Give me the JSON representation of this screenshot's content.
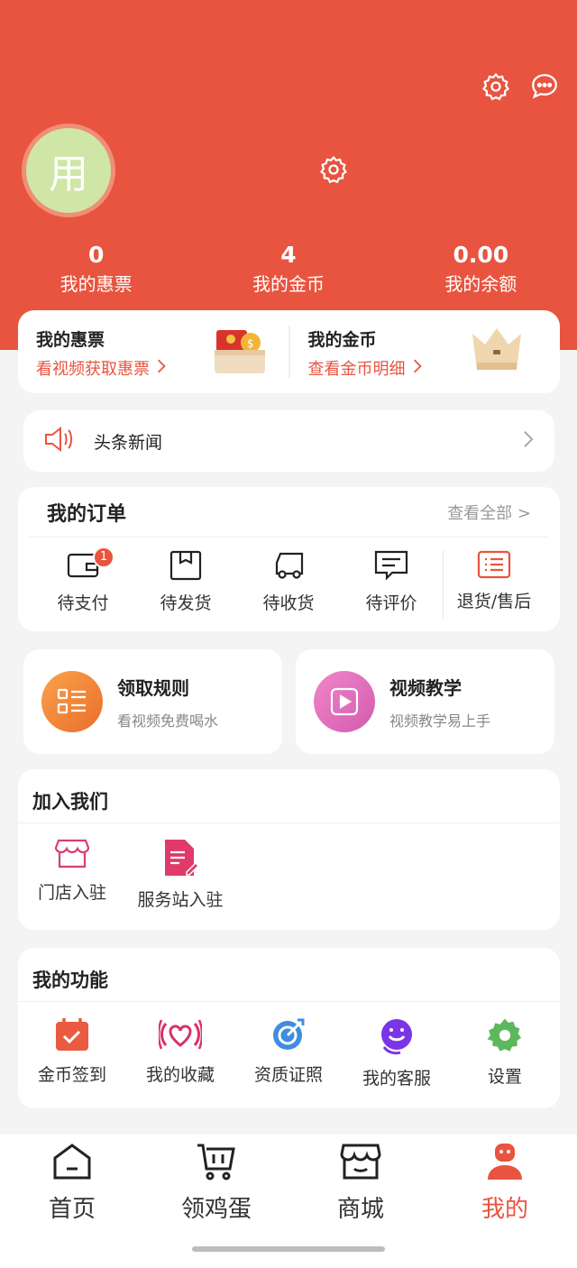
{
  "colors": {
    "brand": "#e8543f",
    "background": "#f4f4f4",
    "card": "#ffffff"
  },
  "header": {
    "avatar_text": "用",
    "settings_icon": "gear-icon",
    "message_icon": "chat-bubble-icon",
    "profile_settings_icon": "gear-icon"
  },
  "stats": [
    {
      "value": "0",
      "label": "我的惠票"
    },
    {
      "value": "4",
      "label": "我的金币"
    },
    {
      "value": "0.00",
      "label": "我的余额"
    }
  ],
  "wallet": {
    "tickets": {
      "title": "我的惠票",
      "subtitle": "看视频获取惠票"
    },
    "coins": {
      "title": "我的金币",
      "subtitle": "查看金币明细"
    }
  },
  "news": {
    "label": "头条新闻"
  },
  "orders": {
    "title": "我的订单",
    "view_all": "查看全部 >",
    "items": [
      {
        "label": "待支付",
        "icon": "wallet-icon",
        "badge": "1"
      },
      {
        "label": "待发货",
        "icon": "package-icon"
      },
      {
        "label": "待收货",
        "icon": "truck-icon"
      },
      {
        "label": "待评价",
        "icon": "comment-icon"
      },
      {
        "label": "退货/售后",
        "icon": "list-icon"
      }
    ]
  },
  "promo": {
    "rules": {
      "title": "领取规则",
      "subtitle": "看视频免费喝水"
    },
    "video": {
      "title": "视频教学",
      "subtitle": "视频教学易上手"
    }
  },
  "join": {
    "title": "加入我们",
    "items": [
      {
        "label": "门店入驻",
        "icon": "store-icon"
      },
      {
        "label": "服务站入驻",
        "icon": "document-edit-icon"
      }
    ]
  },
  "functions": {
    "title": "我的功能",
    "items": [
      {
        "label": "金币签到",
        "icon": "calendar-check-icon"
      },
      {
        "label": "我的收藏",
        "icon": "heart-icon"
      },
      {
        "label": "资质证照",
        "icon": "target-icon"
      },
      {
        "label": "我的客服",
        "icon": "support-icon"
      },
      {
        "label": "设置",
        "icon": "gear-icon"
      }
    ]
  },
  "tabbar": {
    "items": [
      {
        "label": "首页",
        "icon": "home-icon"
      },
      {
        "label": "领鸡蛋",
        "icon": "cart-icon"
      },
      {
        "label": "商城",
        "icon": "shop-icon"
      },
      {
        "label": "我的",
        "icon": "user-icon",
        "active": true
      }
    ]
  }
}
